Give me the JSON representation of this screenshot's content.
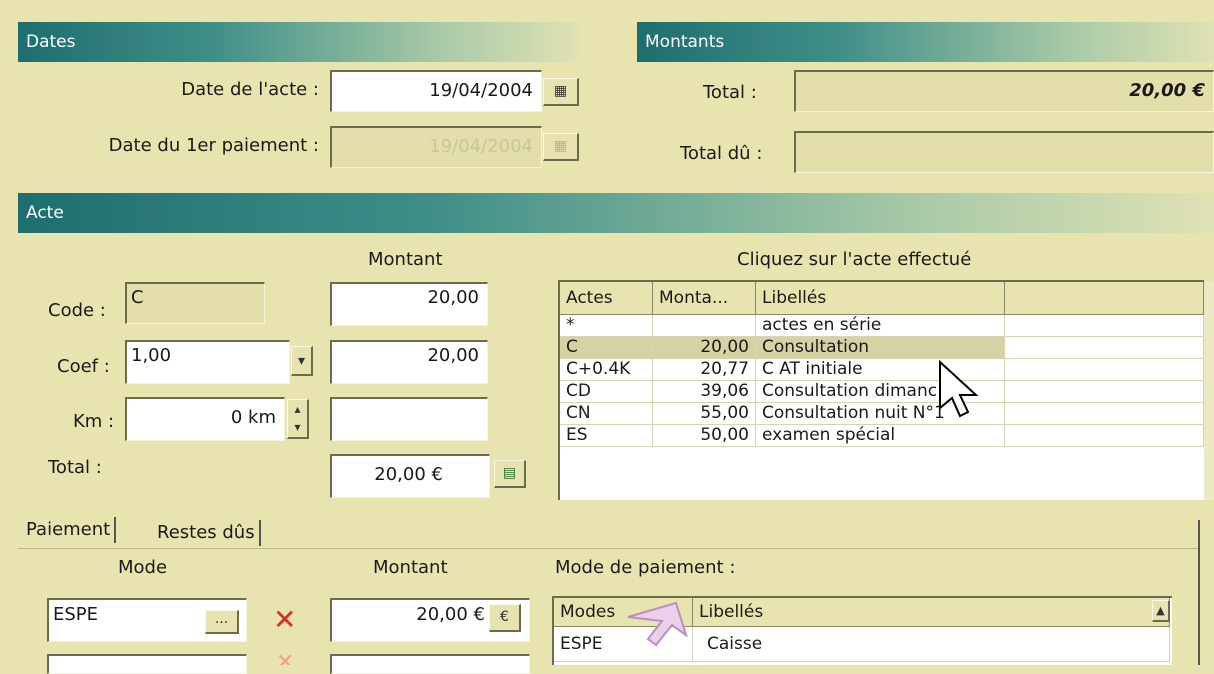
{
  "dates": {
    "header": "Dates",
    "date_acte_label": "Date de l'acte :",
    "date_acte_value": "19/04/2004",
    "date_paiement_label": "Date du 1er paiement :",
    "date_paiement_value": "19/04/2004"
  },
  "montants": {
    "header": "Montants",
    "total_label": "Total :",
    "total_value": "20,00 €",
    "total_du_label": "Total dû :",
    "total_du_value": ""
  },
  "acte": {
    "header": "Acte",
    "montant_header": "Montant",
    "grid_title": "Cliquez sur l'acte effectué",
    "code_label": "Code :",
    "code_value": "C",
    "code_montant": "20,00",
    "coef_label": "Coef :",
    "coef_value": "1,00",
    "coef_montant": "20,00",
    "km_label": "Km :",
    "km_value": "0 km",
    "km_montant": "",
    "total_label": "Total :",
    "total_value": "20,00 €",
    "columns": [
      "Actes",
      "Monta...",
      "Libellés",
      ""
    ],
    "rows": [
      {
        "code": "*",
        "montant": "",
        "libelle": "actes en série"
      },
      {
        "code": "C",
        "montant": "20,00",
        "libelle": "Consultation"
      },
      {
        "code": "C+0.4K",
        "montant": "20,77",
        "libelle": "C AT initiale"
      },
      {
        "code": "CD",
        "montant": "39,06",
        "libelle": "Consultation dimanc..."
      },
      {
        "code": "CN",
        "montant": "55,00",
        "libelle": "Consultation nuit N°1"
      },
      {
        "code": "ES",
        "montant": "50,00",
        "libelle": "examen spécial"
      }
    ]
  },
  "paiement": {
    "tab_paiement": "Paiement",
    "tab_restes": "Restes dûs",
    "mode_header": "Mode",
    "montant_header": "Montant",
    "mode_value": "ESPE",
    "montant_value": "20,00 €",
    "mode_paiement_label": "Mode de paiement :",
    "columns": [
      "Modes",
      "Libellés"
    ],
    "rows": [
      {
        "mode": "ESPE",
        "libelle": "Caisse"
      }
    ]
  },
  "icons": {
    "ellipsis": "···",
    "euro": "€",
    "delete": "✕"
  },
  "colors": {
    "background": "#e8e4b0",
    "band_dark": "#1f6e6f",
    "delete_red": "#d8301c"
  }
}
